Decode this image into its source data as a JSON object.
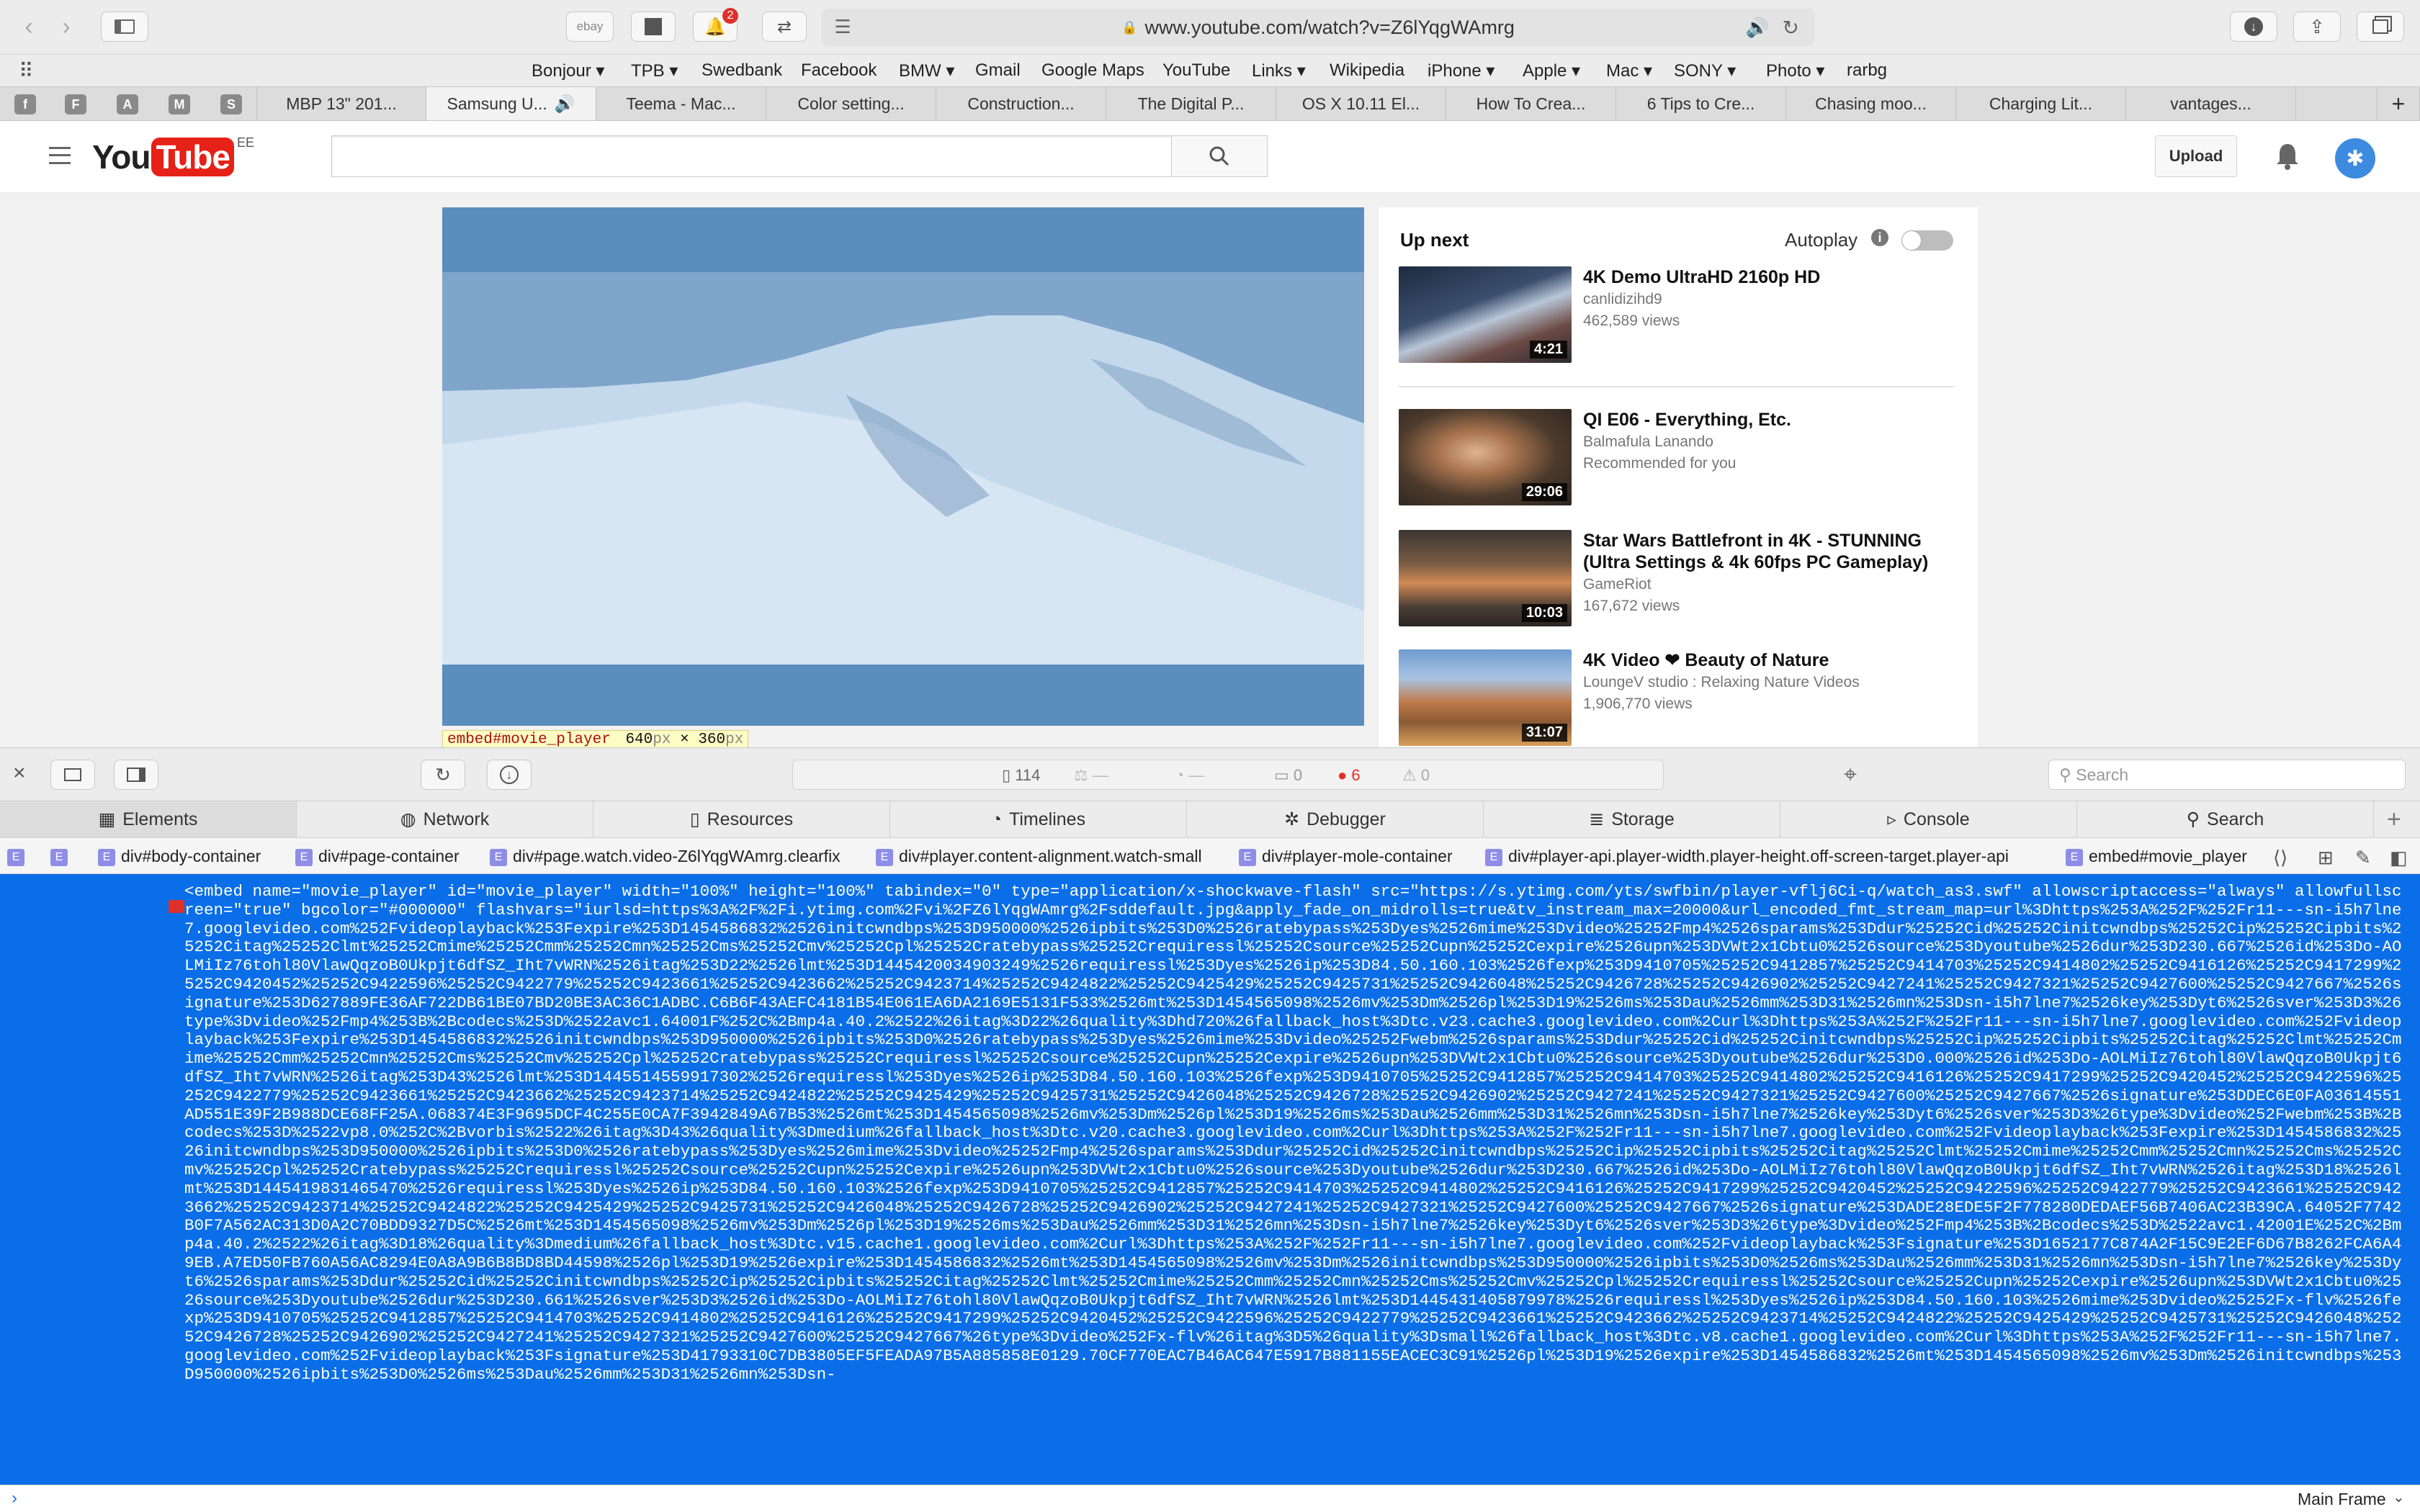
{
  "browser": {
    "url": "www.youtube.com/watch?v=Z6lYqgWAmrg",
    "toolbar_buttons": [
      "ebay"
    ],
    "notification_count": "2",
    "bookmarks": [
      "Bonjour ▾",
      "TPB ▾",
      "Swedbank",
      "Facebook",
      "BMW ▾",
      "Gmail",
      "Google Maps",
      "YouTube",
      "Links ▾",
      "Wikipedia",
      "iPhone ▾",
      "Apple ▾",
      "Mac ▾",
      "SONY ▾",
      "Photo ▾",
      "rarbg"
    ],
    "pinned_tabs": [
      "f",
      "F",
      "A",
      "M",
      "S"
    ],
    "tabs": [
      "MBP 13\" 201...",
      "Samsung U...",
      "Teema - Mac...",
      "Color setting...",
      "Construction...",
      "The Digital P...",
      "OS X 10.11 El...",
      "How To Crea...",
      "6 Tips to Cre...",
      "Chasing moo...",
      "Charging Lit...",
      "vantages..."
    ],
    "add_tab": "+"
  },
  "youtube": {
    "logo_you": "You",
    "logo_tube": "Tube",
    "logo_region": "EE",
    "upload_label": "Upload",
    "player_tooltip_tag": "embed#movie_player",
    "player_tooltip_w": "640",
    "player_tooltip_h": "360",
    "player_tooltip_unit": "px",
    "player_tooltip_sep": "×",
    "up_next_label": "Up next",
    "autoplay_label": "Autoplay",
    "videos": [
      {
        "title": "4K Demo UltraHD 2160p HD",
        "channel": "canlidizihd9",
        "meta": "462,589 views",
        "duration": "4:21"
      },
      {
        "title": "QI E06 - Everything, Etc.",
        "channel": "Balmafula Lanando",
        "meta": "Recommended for you",
        "duration": "29:06"
      },
      {
        "title": "Star Wars Battlefront in 4K - STUNNING (Ultra Settings & 4k 60fps PC Gameplay)",
        "channel": "GameRiot",
        "meta": "167,672 views",
        "duration": "10:03"
      },
      {
        "title": "4K Video ❤ Beauty of Nature",
        "channel": "LoungeV studio : Relaxing Nature Videos",
        "meta": "1,906,770 views",
        "duration": "31:07"
      }
    ]
  },
  "devtools": {
    "resource_count": "114",
    "dash1": "—",
    "dash2": "—",
    "log_count": "0",
    "error_count": "6",
    "warning_count": "0",
    "search_placeholder": "Search",
    "tabs": [
      "Elements",
      "Network",
      "Resources",
      "Timelines",
      "Debugger",
      "Storage",
      "Console",
      "Search"
    ],
    "breadcrumbs": [
      "div#body-container",
      "div#page-container",
      "div#page.watch.video-Z6lYqgWAmrg.clearfix",
      "div#player.content-alignment.watch-small",
      "div#player-mole-container",
      "div#player-api.player-width.player-height.off-screen-target.player-api",
      "embed#movie_player"
    ],
    "dom_text": "<embed name=\"movie_player\" id=\"movie_player\" width=\"100%\" height=\"100%\" tabindex=\"0\" type=\"application/x-shockwave-flash\" src=\"https://s.ytimg.com/yts/swfbin/player-vflj6Ci-q/watch_as3.swf\" allowscriptaccess=\"always\" allowfullscreen=\"true\" bgcolor=\"#000000\" flashvars=\"iurlsd=https%3A%2F%2Fi.ytimg.com%2Fvi%2FZ6lYqgWAmrg%2Fsddefault.jpg&apply_fade_on_midrolls=true&tv_instream_max=20000&url_encoded_fmt_stream_map=url%3Dhttps%253A%252F%252Fr11---sn-i5h7lne7.googlevideo.com%252Fvideoplayback%253Fexpire%253D1454586832%2526initcwndbps%253D950000%2526ipbits%253D0%2526ratebypass%253Dyes%2526mime%253Dvideo%25252Fmp4%2526sparams%253Ddur%25252Cid%25252Cinitcwndbps%25252Cip%25252Cipbits%25252Citag%25252Clmt%25252Cmime%25252Cmm%25252Cmn%25252Cms%25252Cmv%25252Cpl%25252Cratebypass%25252Crequiressl%25252Csource%25252Cupn%25252Cexpire%2526upn%253DVWt2x1Cbtu0%2526source%253Dyoutube%2526dur%253D230.667%2526id%253Do-AOLMiIz76tohl80VlawQqzoB0Ukpjt6dfSZ_Iht7vWRN%2526itag%253D22%2526lmt%253D1445420034903249%2526requiressl%253Dyes%2526ip%253D84.50.160.103%2526fexp%253D9410705%25252C9412857%25252C9414703%25252C9414802%25252C9416126%25252C9417299%25252C9420452%25252C9422596%25252C9422779%25252C9423661%25252C9423662%25252C9423714%25252C9424822%25252C9425429%25252C9425731%25252C9426048%25252C9426728%25252C9426902%25252C9427241%25252C9427321%25252C9427600%25252C9427667%2526signature%253D627889FE36AF722DB61BE07BD20BE3AC36C1ADBC.C6B6F43AEFC4181B54E061EA6DA2169E5131F533%2526mt%253D1454565098%2526mv%253Dm%2526pl%253D19%2526ms%253Dau%2526mm%253D31%2526mn%253Dsn-i5h7lne7%2526key%253Dyt6%2526sver%253D3%26type%3Dvideo%252Fmp4%253B%2Bcodecs%253D%2522avc1.64001F%252C%2Bmp4a.40.2%2522%26itag%3D22%26quality%3Dhd720%26fallback_host%3Dtc.v23.cache3.googlevideo.com%2Curl%3Dhttps%253A%252F%252Fr11---sn-i5h7lne7.googlevideo.com%252Fvideoplayback%253Fexpire%253D1454586832%2526initcwndbps%253D950000%2526ipbits%253D0%2526ratebypass%253Dyes%2526mime%253Dvideo%25252Fwebm%2526sparams%253Ddur%25252Cid%25252Cinitcwndbps%25252Cip%25252Cipbits%25252Citag%25252Clmt%25252Cmime%25252Cmm%25252Cmn%25252Cms%25252Cmv%25252Cpl%25252Cratebypass%25252Crequiressl%25252Csource%25252Cupn%25252Cexpire%2526upn%253DVWt2x1Cbtu0%2526source%253Dyoutube%2526dur%253D0.000%2526id%253Do-AOLMiIz76tohl80VlawQqzoB0Ukpjt6dfSZ_Iht7vWRN%2526itag%253D43%2526lmt%253D1445514559917302%2526requiressl%253Dyes%2526ip%253D84.50.160.103%2526fexp%253D9410705%25252C9412857%25252C9414703%25252C9414802%25252C9416126%25252C9417299%25252C9420452%25252C9422596%25252C9422779%25252C9423661%25252C9423662%25252C9423714%25252C9424822%25252C9425429%25252C9425731%25252C9426048%25252C9426728%25252C9426902%25252C9427241%25252C9427321%25252C9427600%25252C9427667%2526signature%253DDEC6E0FA03614551AD551E39F2B988DCE68FF25A.068374E3F9695DCF4C255E0CA7F3942849A67B53%2526mt%253D1454565098%2526mv%253Dm%2526pl%253D19%2526ms%253Dau%2526mm%253D31%2526mn%253Dsn-i5h7lne7%2526key%253Dyt6%2526sver%253D3%26type%3Dvideo%252Fwebm%253B%2Bcodecs%253D%2522vp8.0%252C%2Bvorbis%2522%26itag%3D43%26quality%3Dmedium%26fallback_host%3Dtc.v20.cache3.googlevideo.com%2Curl%3Dhttps%253A%252F%252Fr11---sn-i5h7lne7.googlevideo.com%252Fvideoplayback%253Fexpire%253D1454586832%2526initcwndbps%253D950000%2526ipbits%253D0%2526ratebypass%253Dyes%2526mime%253Dvideo%25252Fmp4%2526sparams%253Ddur%25252Cid%25252Cinitcwndbps%25252Cip%25252Cipbits%25252Citag%25252Clmt%25252Cmime%25252Cmm%25252Cmn%25252Cms%25252Cmv%25252Cpl%25252Cratebypass%25252Crequiressl%25252Csource%25252Cupn%25252Cexpire%2526upn%253DVWt2x1Cbtu0%2526source%253Dyoutube%2526dur%253D230.667%2526id%253Do-AOLMiIz76tohl80VlawQqzoB0Ukpjt6dfSZ_Iht7vWRN%2526itag%253D18%2526lmt%253D1445419831465470%2526requiressl%253Dyes%2526ip%253D84.50.160.103%2526fexp%253D9410705%25252C9412857%25252C9414703%25252C9414802%25252C9416126%25252C9417299%25252C9420452%25252C9422596%25252C9422779%25252C9423661%25252C9423662%25252C9423714%25252C9424822%25252C9425429%25252C9425731%25252C9426048%25252C9426728%25252C9426902%25252C9427241%25252C9427321%25252C9427600%25252C9427667%2526signature%253DADE28EDE5F2F778280DEDAEF56B7406AC23B39CA.64052F7742B0F7A562AC313D0A2C70BDD9327D5C%2526mt%253D1454565098%2526mv%253Dm%2526pl%253D19%2526ms%253Dau%2526mm%253D31%2526mn%253Dsn-i5h7lne7%2526key%253Dyt6%2526sver%253D3%26type%3Dvideo%252Fmp4%253B%2Bcodecs%253D%2522avc1.42001E%252C%2Bmp4a.40.2%2522%26itag%3D18%26quality%3Dmedium%26fallback_host%3Dtc.v15.cache1.googlevideo.com%2Curl%3Dhttps%253A%252F%252Fr11---sn-i5h7lne7.googlevideo.com%252Fvideoplayback%253Fsignature%253D1652177C874A2F15C9E2EF6D67B8262FCA6A49EB.A7ED50FB760A56AC8294E0A8A9B6B8BD8BD44598%2526pl%253D19%2526expire%253D1454586832%2526mt%253D1454565098%2526mv%253Dm%2526initcwndbps%253D950000%2526ipbits%253D0%2526ms%253Dau%2526mm%253D31%2526mn%253Dsn-i5h7lne7%2526key%253Dyt6%2526sparams%253Ddur%25252Cid%25252Cinitcwndbps%25252Cip%25252Cipbits%25252Citag%25252Clmt%25252Cmime%25252Cmm%25252Cmn%25252Cms%25252Cmv%25252Cpl%25252Crequiressl%25252Csource%25252Cupn%25252Cexpire%2526upn%253DVWt2x1Cbtu0%2526source%253Dyoutube%2526dur%253D230.661%2526sver%253D3%2526id%253Do-AOLMiIz76tohl80VlawQqzoB0Ukpjt6dfSZ_Iht7vWRN%2526lmt%253D1445431405879978%2526requiressl%253Dyes%2526ip%253D84.50.160.103%2526mime%253Dvideo%25252Fx-flv%2526fexp%253D9410705%25252C9412857%25252C9414703%25252C9414802%25252C9416126%25252C9417299%25252C9420452%25252C9422596%25252C9422779%25252C9423661%25252C9423662%25252C9423714%25252C9424822%25252C9425429%25252C9425731%25252C9426048%25252C9426728%25252C9426902%25252C9427241%25252C9427321%25252C9427600%25252C9427667%26type%3Dvideo%252Fx-flv%26itag%3D5%26quality%3Dsmall%26fallback_host%3Dtc.v8.cache1.googlevideo.com%2Curl%3Dhttps%253A%252F%252Fr11---sn-i5h7lne7.googlevideo.com%252Fvideoplayback%253Fsignature%253D41793310C7DB3805EF5FEADA97B5A885858E0129.70CF770EAC7B46AC647E5917B881155EACEC3C91%2526pl%253D19%2526expire%253D1454586832%2526mt%253D1454565098%2526mv%253Dm%2526initcwndbps%253D950000%2526ipbits%253D0%2526ms%253Dau%2526mm%253D31%2526mn%253Dsn-",
    "frame_selector": "Main Frame"
  },
  "colors": {
    "youtube_red": "#e62117",
    "devtools_selection": "#0a6ee8",
    "error_red": "#e0302a"
  }
}
